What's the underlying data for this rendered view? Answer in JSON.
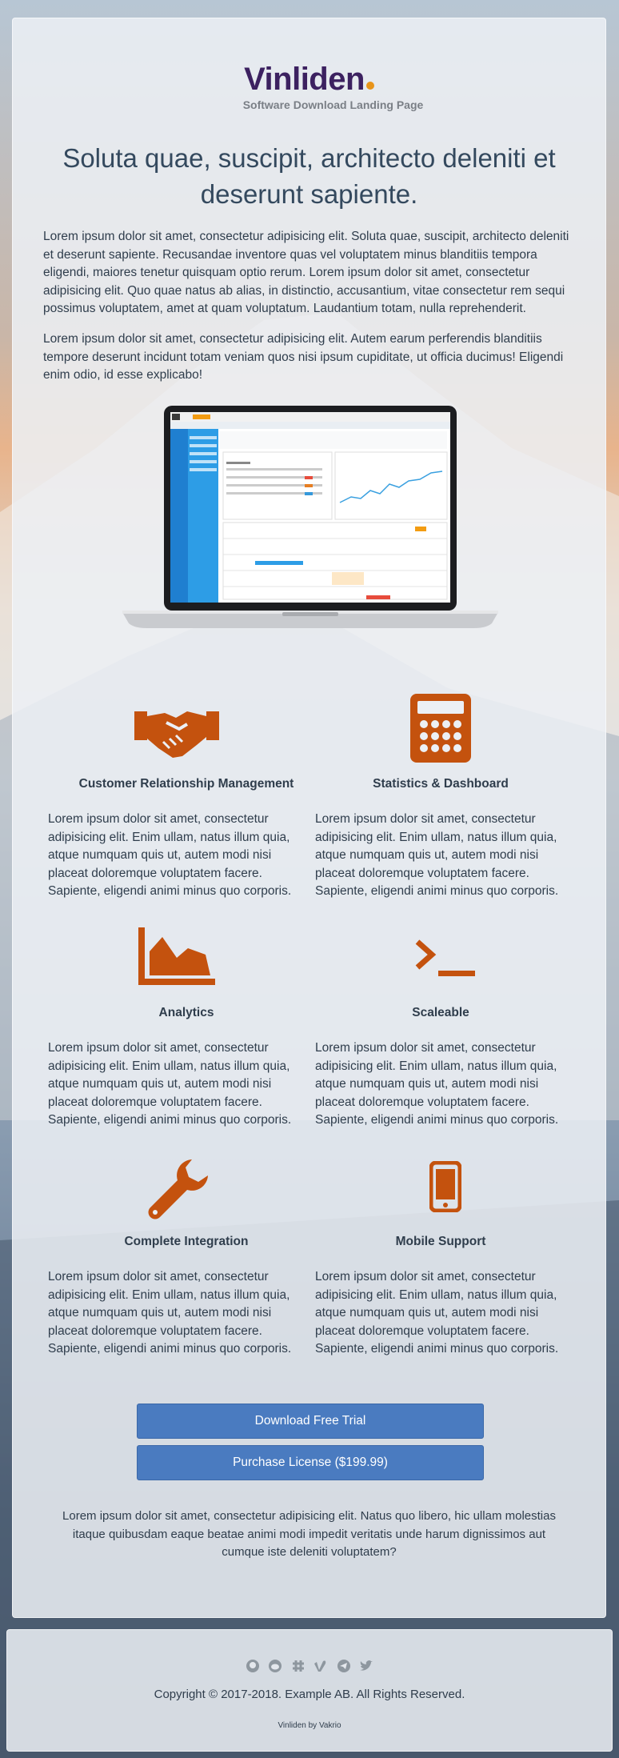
{
  "brand": {
    "name": "Vinliden",
    "subtitle": "Software Download Landing Page"
  },
  "hero": {
    "headline": "Soluta quae, suscipit, architecto deleniti et deserunt sapiente.",
    "paragraph_1": "Lorem ipsum dolor sit amet, consectetur adipisicing elit. Soluta quae, suscipit, architecto deleniti et deserunt sapiente. Recusandae inventore quas vel voluptatem minus blanditiis tempora eligendi, maiores tenetur quisquam optio rerum. Lorem ipsum dolor sit amet, consectetur adipisicing elit. Quo quae natus ab alias, in distinctio, accusantium, vitae consectetur rem sequi possimus voluptatem, amet at quam voluptatum. Laudantium totam, nulla reprehenderit.",
    "paragraph_2": "Lorem ipsum dolor sit amet, consectetur adipisicing elit. Autem earum perferendis blanditiis tempore deserunt incidunt totam veniam quos nisi ipsum cupiditate, ut officia ducimus! Eligendi enim odio, id esse explicabo!"
  },
  "features": [
    {
      "icon": "handshake-icon",
      "title": "Customer Relationship Management",
      "text": "Lorem ipsum dolor sit amet, consectetur adipisicing elit. Enim ullam, natus illum quia, atque numquam quis ut, autem modi nisi placeat doloremque voluptatem facere. Sapiente, eligendi animi minus quo corporis."
    },
    {
      "icon": "calculator-icon",
      "title": "Statistics & Dashboard",
      "text": "Lorem ipsum dolor sit amet, consectetur adipisicing elit. Enim ullam, natus illum quia, atque numquam quis ut, autem modi nisi placeat doloremque voluptatem facere. Sapiente, eligendi animi minus quo corporis."
    },
    {
      "icon": "area-chart-icon",
      "title": "Analytics",
      "text": "Lorem ipsum dolor sit amet, consectetur adipisicing elit. Enim ullam, natus illum quia, atque numquam quis ut, autem modi nisi placeat doloremque voluptatem facere. Sapiente, eligendi animi minus quo corporis."
    },
    {
      "icon": "terminal-icon",
      "title": "Scaleable",
      "text": "Lorem ipsum dolor sit amet, consectetur adipisicing elit. Enim ullam, natus illum quia, atque numquam quis ut, autem modi nisi placeat doloremque voluptatem facere. Sapiente, eligendi animi minus quo corporis."
    },
    {
      "icon": "wrench-icon",
      "title": "Complete Integration",
      "text": "Lorem ipsum dolor sit amet, consectetur adipisicing elit. Enim ullam, natus illum quia, atque numquam quis ut, autem modi nisi placeat doloremque voluptatem facere. Sapiente, eligendi animi minus quo corporis."
    },
    {
      "icon": "mobile-phone-icon",
      "title": "Mobile Support",
      "text": "Lorem ipsum dolor sit amet, consectetur adipisicing elit. Enim ullam, natus illum quia, atque numquam quis ut, autem modi nisi placeat doloremque voluptatem facere. Sapiente, eligendi animi minus quo corporis."
    }
  ],
  "actions": {
    "download_label": "Download Free Trial",
    "purchase_label": "Purchase License ($199.99)"
  },
  "closing": "Lorem ipsum dolor sit amet, consectetur adipisicing elit. Natus quo libero, hic ullam molestias itaque quibusdam eaque beatae animi modi impedit veritatis unde harum dignissimos aut cumque iste deleniti voluptatem?",
  "footer": {
    "social": [
      "github-icon",
      "reddit-icon",
      "slack-icon",
      "vimeo-icon",
      "telegram-icon",
      "twitter-icon"
    ],
    "copyright": "Copyright © 2017-2018. Example AB. All Rights Reserved.",
    "credit": "Vinliden by Vakrio"
  },
  "colors": {
    "accent": "#c4520e",
    "brand": "#3c2160",
    "brand_dot": "#e8941a",
    "button": "#4a7bc0",
    "text": "#2f3d4c"
  }
}
